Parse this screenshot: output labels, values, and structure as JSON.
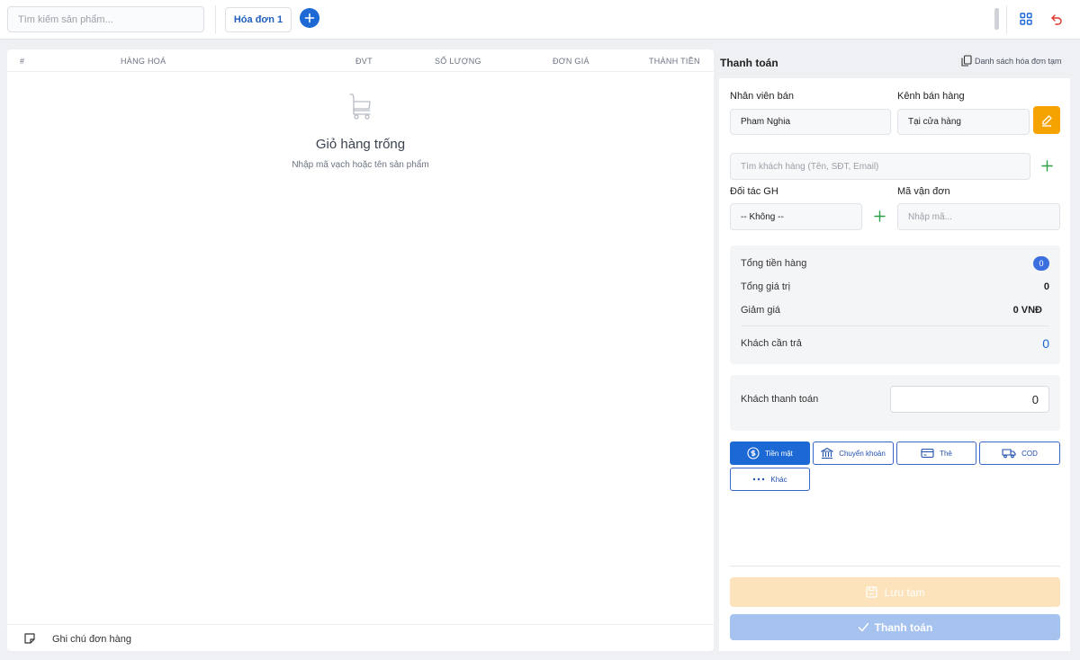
{
  "topbar": {
    "search_placeholder": "Tìm kiếm sản phẩm...",
    "tabs": [
      {
        "label": "Hóa đơn 1"
      }
    ],
    "add_tab_icon": "plus-circle-icon",
    "grid_icon": "grid-icon",
    "back_icon": "undo-arrow-icon"
  },
  "cart": {
    "columns": [
      "#",
      "HÀNG HOÁ",
      "ĐVT",
      "SỐ LƯỢNG",
      "ĐƠN GIÁ",
      "THÀNH TIỀN"
    ],
    "empty_icon": "cart-icon",
    "empty_title": "Giỏ hàng trống",
    "empty_subtitle": "Nhập mã vạch hoặc tên sản phẩm",
    "note_label": "Ghi chú đơn hàng"
  },
  "checkout": {
    "title": "Thanh toán",
    "drafts_link": "Danh sách hóa đơn tạm",
    "seller_label": "Nhân viên bán",
    "seller_value": "Pham Nghia",
    "channel_label": "Kênh bán hàng",
    "channel_value": "Tại cửa hàng",
    "customer_placeholder": "Tìm khách hàng (Tên, SĐT, Email)",
    "shipping_partner_label": "Đối tác GH",
    "shipping_partner_value": "-- Không --",
    "waybill_label": "Mã vận đơn",
    "waybill_placeholder": "Nhập mã...",
    "summary": {
      "total_goods_label": "Tổng tiền hàng",
      "total_goods_count": "0",
      "total_value_label": "Tổng giá trị",
      "total_value": "0",
      "discount_label": "Giảm giá",
      "discount_value": "0 VNĐ",
      "due_label": "Khách cần trả",
      "due_value": "0"
    },
    "customer_pays_label": "Khách thanh toán",
    "customer_pays_value": "0",
    "payment_methods": [
      {
        "label": "Tiền mặt",
        "icon": "dollar-circle-icon",
        "active": true
      },
      {
        "label": "Chuyển khoản",
        "icon": "bank-icon",
        "active": false
      },
      {
        "label": "Thẻ",
        "icon": "card-icon",
        "active": false
      },
      {
        "label": "COD",
        "icon": "truck-icon",
        "active": false
      },
      {
        "label": "Khác",
        "icon": "more-dots-icon",
        "active": false
      }
    ],
    "save_draft_label": "Lưu tạm",
    "checkout_button_label": "Thanh toán",
    "colors": {
      "primary": "#1c68d4",
      "edit_button": "#f5a300",
      "save_draft_bg": "#fce3bb",
      "checkout_bg": "#a6c2ee",
      "due_value": "#1c68d4",
      "add_green": "#2e9e45"
    }
  }
}
